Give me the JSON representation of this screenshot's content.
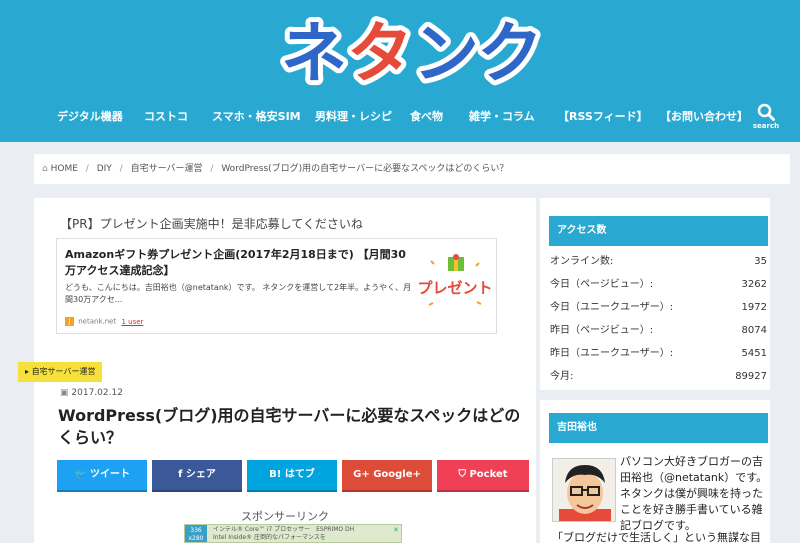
{
  "site": {
    "logo": [
      "ネ",
      "タ",
      "ン",
      "ク"
    ],
    "colors": {
      "brand": "#29a9d2",
      "accent_red": "#e64a3b",
      "logo_blue": "#2f67c9"
    }
  },
  "nav": {
    "items": [
      "デジタル機器",
      "コストコ",
      "スマホ・格安SIM",
      "男料理・レシピ",
      "食べ物",
      "雑学・コラム",
      "【RSSフィード】",
      "【お問い合わせ】"
    ],
    "search_label": "search",
    "search_icon": "search-icon"
  },
  "breadcrumb": {
    "home": "HOME",
    "items": [
      "DIY",
      "自宅サーバー運営",
      "WordPress(ブログ)用の自宅サーバーに必要なスペックはどのくらい？"
    ],
    "separator": "/"
  },
  "pr": {
    "title": "【PR】プレゼント企画実施中！是非応募してくださいね",
    "card_title": "Amazonギフト券プレゼント企画(2017年2月18日まで) 【月間30万アクセス達成記念】",
    "card_desc": "どうも、こんにちは。吉田裕也（@netatank）です。 ネタンクを運営して2年半。ようやく、月間30万アクセ...",
    "card_source": "netank.net",
    "card_users": "1 user",
    "thumb_text": "プレゼント"
  },
  "post": {
    "category": "自宅サーバー運営",
    "date": "2017.02.12",
    "title": "WordPress(ブログ)用の自宅サーバーに必要なスペックはどのくらい？"
  },
  "share": [
    {
      "icon": "twitter-icon",
      "glyph": "🐦",
      "label": "ツイート",
      "color": "#1da1f2"
    },
    {
      "icon": "facebook-icon",
      "glyph": "f",
      "label": "シェア",
      "color": "#3b5998"
    },
    {
      "icon": "hatena-icon",
      "glyph": "B!",
      "label": "はてブ",
      "color": "#00a4de"
    },
    {
      "icon": "google-plus-icon",
      "glyph": "G+",
      "label": "Google+",
      "color": "#dd4b39"
    },
    {
      "icon": "pocket-icon",
      "glyph": "⛉",
      "label": "Pocket",
      "color": "#ef4056"
    }
  ],
  "sponsor": "スポンサーリンク",
  "ad": {
    "size": "336\nx280",
    "line1": "インテル® Core™ i7 プロセッサー　ESPRIMO DH",
    "line2": "Intel Inside® 圧倒的なパフォーマンスを",
    "close": "✕"
  },
  "sidebar": {
    "access_title": "アクセス数",
    "stats": [
      {
        "label": "オンライン数:",
        "value": "35"
      },
      {
        "label": "今日（ページビュー）:",
        "value": "3262"
      },
      {
        "label": "今日（ユニークユーザー）:",
        "value": "1972"
      },
      {
        "label": "昨日（ページビュー）:",
        "value": "8074"
      },
      {
        "label": "昨日（ユニークユーザー）:",
        "value": "5451"
      },
      {
        "label": "今月:",
        "value": "89927"
      }
    ],
    "profile_title": "吉田裕也",
    "profile_text": "パソコン大好きブロガーの吉田裕也（@netatank）です。ネタンクは僕が興味を持ったことを好き勝手書いている雑記ブログです。",
    "profile_text2": "「ブログだけで生活しく」という無謀な目標を"
  }
}
